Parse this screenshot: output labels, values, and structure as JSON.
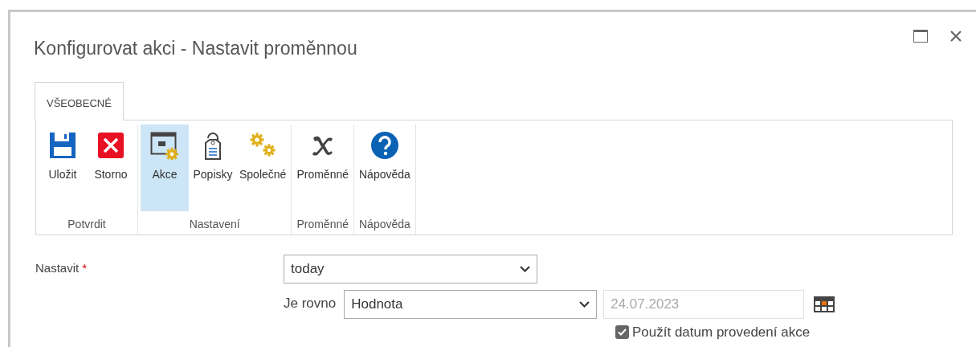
{
  "window": {
    "title": "Konfigurovat akci - Nastavit proměnnou"
  },
  "tabs": [
    {
      "label": "VŠEOBECNÉ",
      "selected": true
    }
  ],
  "ribbon_groups": [
    {
      "label": "Potvrdit",
      "items": [
        {
          "label": "Uložit",
          "selected": false
        },
        {
          "label": "Storno",
          "selected": false
        }
      ]
    },
    {
      "label": "Nastavení",
      "items": [
        {
          "label": "Akce",
          "selected": true
        },
        {
          "label": "Popisky",
          "selected": false
        },
        {
          "label": "Společné",
          "selected": false
        }
      ]
    },
    {
      "label": "Proměnné",
      "items": [
        {
          "label": "Proměnné",
          "selected": false
        }
      ]
    },
    {
      "label": "Nápověda",
      "items": [
        {
          "label": "Nápověda",
          "selected": false
        }
      ]
    }
  ],
  "form": {
    "label": "Nastavit",
    "required_mark": "*",
    "variable": "today",
    "condition_label": "Je rovno",
    "condition": "Hodnota",
    "date": {
      "value": "24.07.2023",
      "disabled": true
    },
    "checkbox": {
      "label": "Použít datum provedení akce",
      "checked": true
    }
  }
}
